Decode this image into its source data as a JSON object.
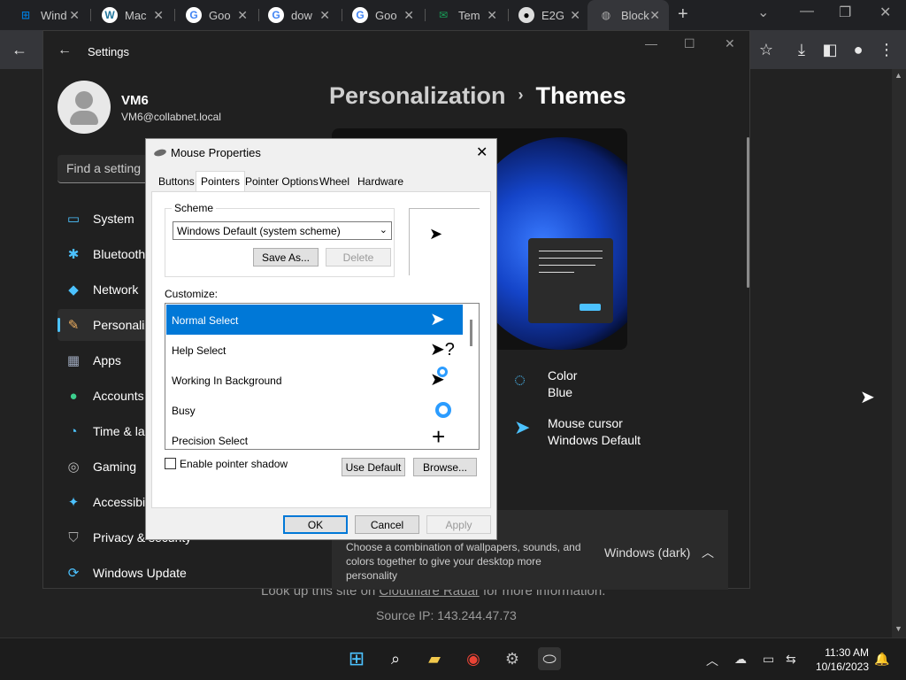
{
  "browser": {
    "tabs": [
      {
        "label": "Wind",
        "icon": "windows-icon",
        "color": "#0078d4"
      },
      {
        "label": "Mac",
        "icon": "wordpress-icon",
        "color": "#21759b"
      },
      {
        "label": "Goo",
        "icon": "google-icon",
        "color": "#4285f4"
      },
      {
        "label": "dow",
        "icon": "google-icon",
        "color": "#4285f4"
      },
      {
        "label": "Goo",
        "icon": "google-icon",
        "color": "#4285f4"
      },
      {
        "label": "Tem",
        "icon": "mail-icon",
        "color": "#18a058"
      },
      {
        "label": "E2G",
        "icon": "github-icon",
        "color": "#333333"
      },
      {
        "label": "Block",
        "icon": "globe-icon",
        "color": "#888888"
      }
    ],
    "new_tab": "+",
    "webpage": {
      "lookup_prefix": "Look up this site on ",
      "lookup_link": "Cloudflare Radar",
      "lookup_suffix": " for more information.",
      "source_ip": "Source IP: 143.244.47.73"
    }
  },
  "settings": {
    "title": "Settings",
    "user": {
      "name": "VM6",
      "email": "VM6@collabnet.local"
    },
    "search_placeholder": "Find a setting",
    "nav": [
      {
        "label": "System",
        "icon": "system-icon"
      },
      {
        "label": "Bluetooth",
        "icon": "bluetooth-icon"
      },
      {
        "label": "Network",
        "icon": "network-icon"
      },
      {
        "label": "Personaliz",
        "icon": "brush-icon"
      },
      {
        "label": "Apps",
        "icon": "apps-icon"
      },
      {
        "label": "Accounts",
        "icon": "accounts-icon"
      },
      {
        "label": "Time & la",
        "icon": "clock-icon"
      },
      {
        "label": "Gaming",
        "icon": "gamepad-icon"
      },
      {
        "label": "Accessibi",
        "icon": "accessibility-icon"
      },
      {
        "label": "Privacy & security",
        "icon": "shield-icon"
      },
      {
        "label": "Windows Update",
        "icon": "update-icon"
      }
    ],
    "breadcrumb": {
      "parent": "Personalization",
      "sep": "›",
      "current": "Themes"
    },
    "color_option": {
      "title": "Color",
      "value": "Blue"
    },
    "cursor_option": {
      "title": "Mouse cursor",
      "value": "Windows Default"
    },
    "theme_bar": {
      "description": "Choose a combination of wallpapers, sounds, and colors together to give your desktop more personality",
      "value": "Windows (dark)"
    },
    "accent_color": "#4cc2ff"
  },
  "mouse_dialog": {
    "title": "Mouse Properties",
    "tabs": [
      "Buttons",
      "Pointers",
      "Pointer Options",
      "Wheel",
      "Hardware"
    ],
    "active_tab": "Pointers",
    "scheme_label": "Scheme",
    "scheme_value": "Windows Default (system scheme)",
    "save_as": "Save As...",
    "delete": "Delete",
    "customize_label": "Customize:",
    "pointers": [
      {
        "label": "Normal Select"
      },
      {
        "label": "Help Select"
      },
      {
        "label": "Working In Background"
      },
      {
        "label": "Busy"
      },
      {
        "label": "Precision Select"
      }
    ],
    "pointer_shadow": "Enable pointer shadow",
    "use_default": "Use Default",
    "browse": "Browse...",
    "ok": "OK",
    "cancel": "Cancel",
    "apply": "Apply",
    "selection_color": "#0078d7"
  },
  "taskbar": {
    "time": "11:30 AM",
    "date": "10/16/2023"
  }
}
